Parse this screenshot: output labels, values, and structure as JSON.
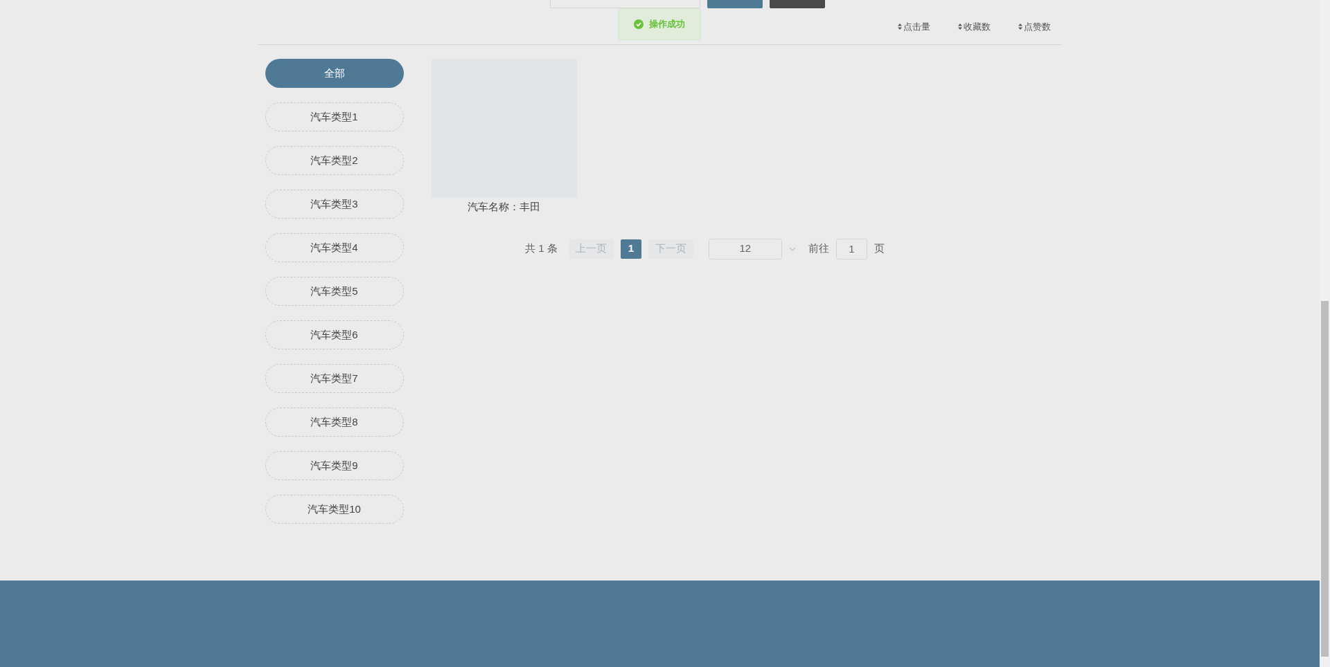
{
  "toast": {
    "kind": "success",
    "message": "操作成功"
  },
  "sort_options": [
    {
      "label": "点击量"
    },
    {
      "label": "收藏数"
    },
    {
      "label": "点赞数"
    }
  ],
  "categories": [
    {
      "label": "全部",
      "selected": true
    },
    {
      "label": "汽车类型1",
      "selected": false
    },
    {
      "label": "汽车类型2",
      "selected": false
    },
    {
      "label": "汽车类型3",
      "selected": false
    },
    {
      "label": "汽车类型4",
      "selected": false
    },
    {
      "label": "汽车类型5",
      "selected": false
    },
    {
      "label": "汽车类型6",
      "selected": false
    },
    {
      "label": "汽车类型7",
      "selected": false
    },
    {
      "label": "汽车类型8",
      "selected": false
    },
    {
      "label": "汽车类型9",
      "selected": false
    },
    {
      "label": "汽车类型10",
      "selected": false
    }
  ],
  "products": [
    {
      "caption": "汽车名称：丰田"
    }
  ],
  "pagination": {
    "total": "共 1 条",
    "prev": {
      "label": "上一页",
      "disabled": true
    },
    "pages": [
      {
        "label": "1",
        "selected": true
      }
    ],
    "next": {
      "label": "下一页",
      "disabled": true
    },
    "page_size": "12",
    "goto_label": "前往",
    "goto_value": "1",
    "page_suffix": "页"
  }
}
